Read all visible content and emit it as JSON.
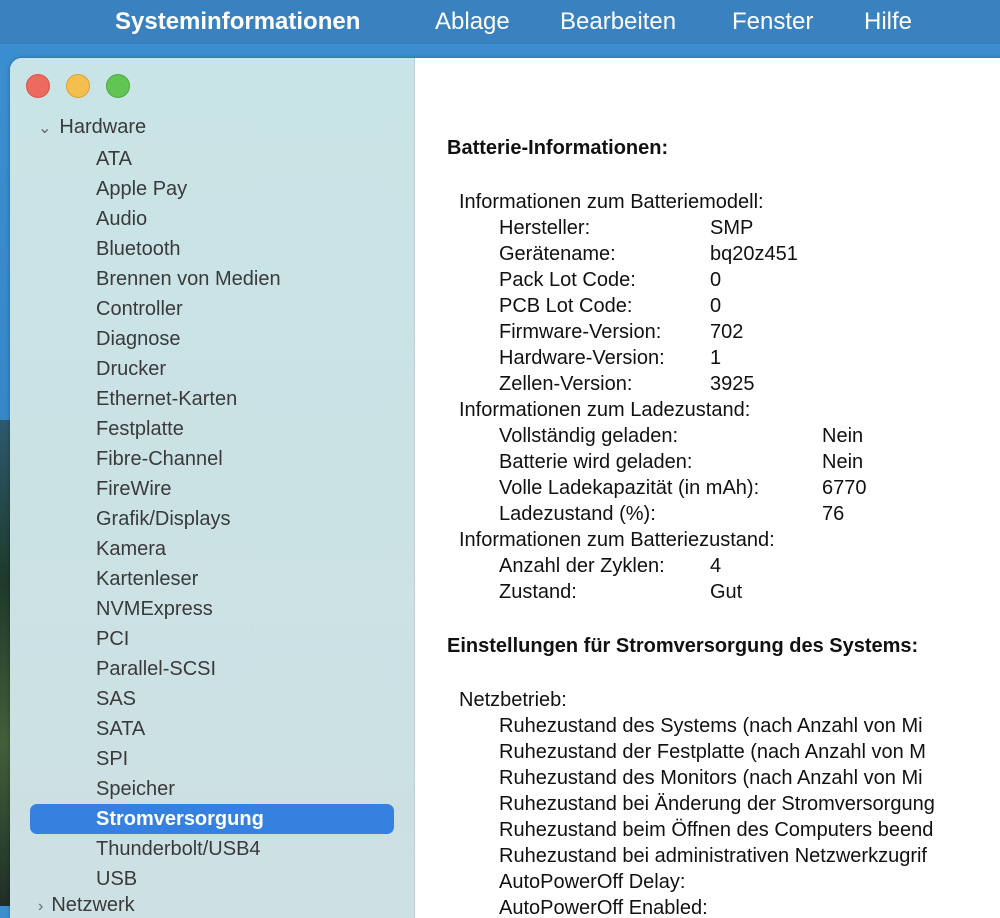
{
  "menubar": {
    "app": "Systeminformationen",
    "items": [
      "Ablage",
      "Bearbeiten",
      "Fenster",
      "Hilfe"
    ]
  },
  "sidebar": {
    "group_hardware": "Hardware",
    "items": [
      "ATA",
      "Apple Pay",
      "Audio",
      "Bluetooth",
      "Brennen von Medien",
      "Controller",
      "Diagnose",
      "Drucker",
      "Ethernet-Karten",
      "Festplatte",
      "Fibre-Channel",
      "FireWire",
      "Grafik/Displays",
      "Kamera",
      "Kartenleser",
      "NVMExpress",
      "PCI",
      "Parallel-SCSI",
      "SAS",
      "SATA",
      "SPI",
      "Speicher",
      "Stromversorgung",
      "Thunderbolt/USB4",
      "USB"
    ],
    "selected": "Stromversorgung",
    "group_network": "Netzwerk"
  },
  "content": {
    "battery_title": "Batterie-Informationen:",
    "model_heading": "Informationen zum Batteriemodell:",
    "model": [
      [
        "Hersteller:",
        "SMP"
      ],
      [
        "Gerätename:",
        "bq20z451"
      ],
      [
        "Pack Lot Code:",
        "0"
      ],
      [
        "PCB Lot Code:",
        "0"
      ],
      [
        "Firmware-Version:",
        "702"
      ],
      [
        "Hardware-Version:",
        "1"
      ],
      [
        "Zellen-Version:",
        "3925"
      ]
    ],
    "charge_heading": "Informationen zum Ladezustand:",
    "charge": [
      [
        "Vollständig geladen:",
        "Nein"
      ],
      [
        "Batterie wird geladen:",
        "Nein"
      ],
      [
        "Volle Ladekapazität (in mAh):",
        "6770"
      ],
      [
        "Ladezustand (%):",
        "76"
      ]
    ],
    "health_heading": "Informationen zum Batteriezustand:",
    "health": [
      [
        "Anzahl der Zyklen:",
        "4"
      ],
      [
        "Zustand:",
        "Gut"
      ]
    ],
    "power_title": "Einstellungen für Stromversorgung des Systems:",
    "ac_heading": "Netzbetrieb:",
    "ac": [
      "Ruhezustand des Systems (nach Anzahl von Mi",
      "Ruhezustand der Festplatte (nach Anzahl von M",
      "Ruhezustand des Monitors (nach Anzahl von Mi",
      "Ruhezustand bei Änderung der Stromversorgung",
      "Ruhezustand beim Öffnen des Computers beend",
      "Ruhezustand bei administrativen Netzwerkzugrif",
      "AutoPowerOff Delay:",
      "AutoPowerOff Enabled:"
    ]
  }
}
